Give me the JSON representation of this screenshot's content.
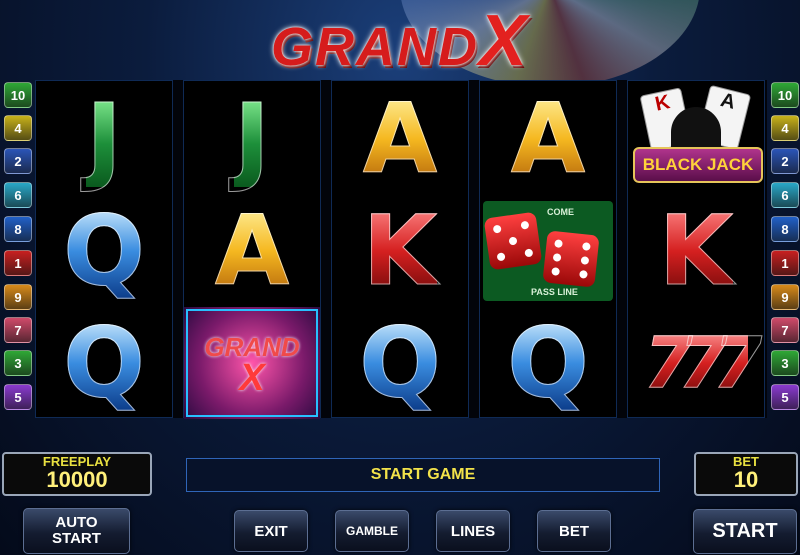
{
  "title": {
    "main": "GRAND",
    "accent": "X"
  },
  "reels": [
    {
      "cells": [
        {
          "symbol": "J"
        },
        {
          "symbol": "Q"
        },
        {
          "symbol": "Q"
        }
      ]
    },
    {
      "cells": [
        {
          "symbol": "J"
        },
        {
          "symbol": "A"
        },
        {
          "symbol": "GRAND X",
          "line1": "GRAND",
          "line2": "X",
          "win": true
        }
      ]
    },
    {
      "cells": [
        {
          "symbol": "A"
        },
        {
          "symbol": "K"
        },
        {
          "symbol": "Q"
        }
      ]
    },
    {
      "cells": [
        {
          "symbol": "A"
        },
        {
          "symbol": "dice",
          "top": "COME",
          "bottom": "PASS LINE",
          "num": "6"
        },
        {
          "symbol": "Q"
        }
      ]
    },
    {
      "cells": [
        {
          "symbol": "BLACK JACK",
          "label": "BLACK JACK"
        },
        {
          "symbol": "K"
        },
        {
          "symbol": "777",
          "text": "777"
        }
      ]
    }
  ],
  "paylines_left": [
    {
      "n": "10",
      "color": "#2fa836"
    },
    {
      "n": "4",
      "color": "#c8b21a"
    },
    {
      "n": "2",
      "color": "#2b55b8"
    },
    {
      "n": "6",
      "color": "#29a8c8"
    },
    {
      "n": "8",
      "color": "#2160c8"
    },
    {
      "n": "1",
      "color": "#c82020"
    },
    {
      "n": "9",
      "color": "#d88a1a"
    },
    {
      "n": "7",
      "color": "#d04a6a"
    },
    {
      "n": "3",
      "color": "#2fa836"
    },
    {
      "n": "5",
      "color": "#8a3ad0"
    }
  ],
  "paylines_right": [
    {
      "n": "10",
      "color": "#2fa836"
    },
    {
      "n": "4",
      "color": "#c8b21a"
    },
    {
      "n": "2",
      "color": "#2b55b8"
    },
    {
      "n": "6",
      "color": "#29a8c8"
    },
    {
      "n": "8",
      "color": "#2160c8"
    },
    {
      "n": "1",
      "color": "#c82020"
    },
    {
      "n": "9",
      "color": "#d88a1a"
    },
    {
      "n": "7",
      "color": "#d04a6a"
    },
    {
      "n": "3",
      "color": "#2fa836"
    },
    {
      "n": "5",
      "color": "#8a3ad0"
    }
  ],
  "freeplay": {
    "label": "FREEPLAY",
    "value": "10000"
  },
  "message": "START GAME",
  "bet": {
    "label": "BET",
    "value": "10"
  },
  "buttons": {
    "auto_start_line1": "AUTO",
    "auto_start_line2": "START",
    "exit": "EXIT",
    "gamble": "GAMBLE",
    "lines": "LINES",
    "bet": "BET",
    "start": "START"
  }
}
